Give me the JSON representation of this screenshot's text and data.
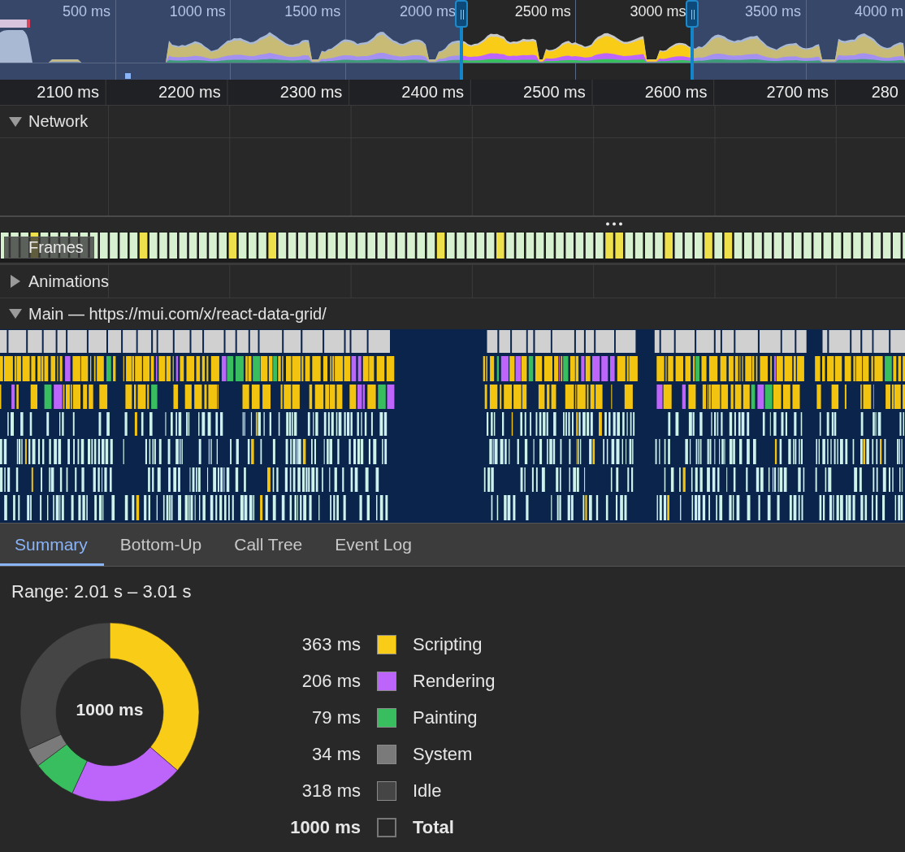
{
  "overview": {
    "ticks": [
      "500 ms",
      "1000 ms",
      "1500 ms",
      "2000 ms",
      "2500 ms",
      "3000 ms",
      "3500 ms",
      "4000 m"
    ]
  },
  "ruler": {
    "ticks": [
      "2100 ms",
      "2200 ms",
      "2300 ms",
      "2400 ms",
      "2500 ms",
      "2600 ms",
      "2700 ms",
      "280"
    ]
  },
  "tracks": [
    {
      "kind": "network",
      "title": "Network",
      "expanded": true
    },
    {
      "kind": "frames",
      "title": "Frames"
    },
    {
      "kind": "animations",
      "title": "Animations",
      "expanded": false
    },
    {
      "kind": "main",
      "title": "Main — https://mui.com/x/react-data-grid/",
      "expanded": true
    }
  ],
  "tabs": [
    {
      "label": "Summary",
      "selected": true
    },
    {
      "label": "Bottom-Up",
      "selected": false
    },
    {
      "label": "Call Tree",
      "selected": false
    },
    {
      "label": "Event Log",
      "selected": false
    }
  ],
  "summary": {
    "range": "Range: 2.01 s – 3.01 s",
    "center_label": "1000 ms",
    "legend": [
      {
        "kind": "category",
        "value": "363 ms",
        "color": "#f9cc17"
      },
      {
        "kind": "category",
        "value": "206 ms",
        "color": "#bd65fb"
      },
      {
        "kind": "category",
        "value": "79 ms",
        "color": "#38bd5f"
      },
      {
        "kind": "category",
        "value": "34 ms",
        "color": "#7a7a7a"
      },
      {
        "kind": "category",
        "value": "318 ms",
        "color": "#454545"
      },
      {
        "kind": "total",
        "value": "1000 ms",
        "label": "Total"
      }
    ],
    "chart_data": {
      "type": "donut",
      "categories": [
        "Scripting",
        "Rendering",
        "Painting",
        "System",
        "Idle"
      ],
      "values": [
        36.3,
        20.6,
        7.9,
        3.4,
        31.8
      ]
    }
  }
}
